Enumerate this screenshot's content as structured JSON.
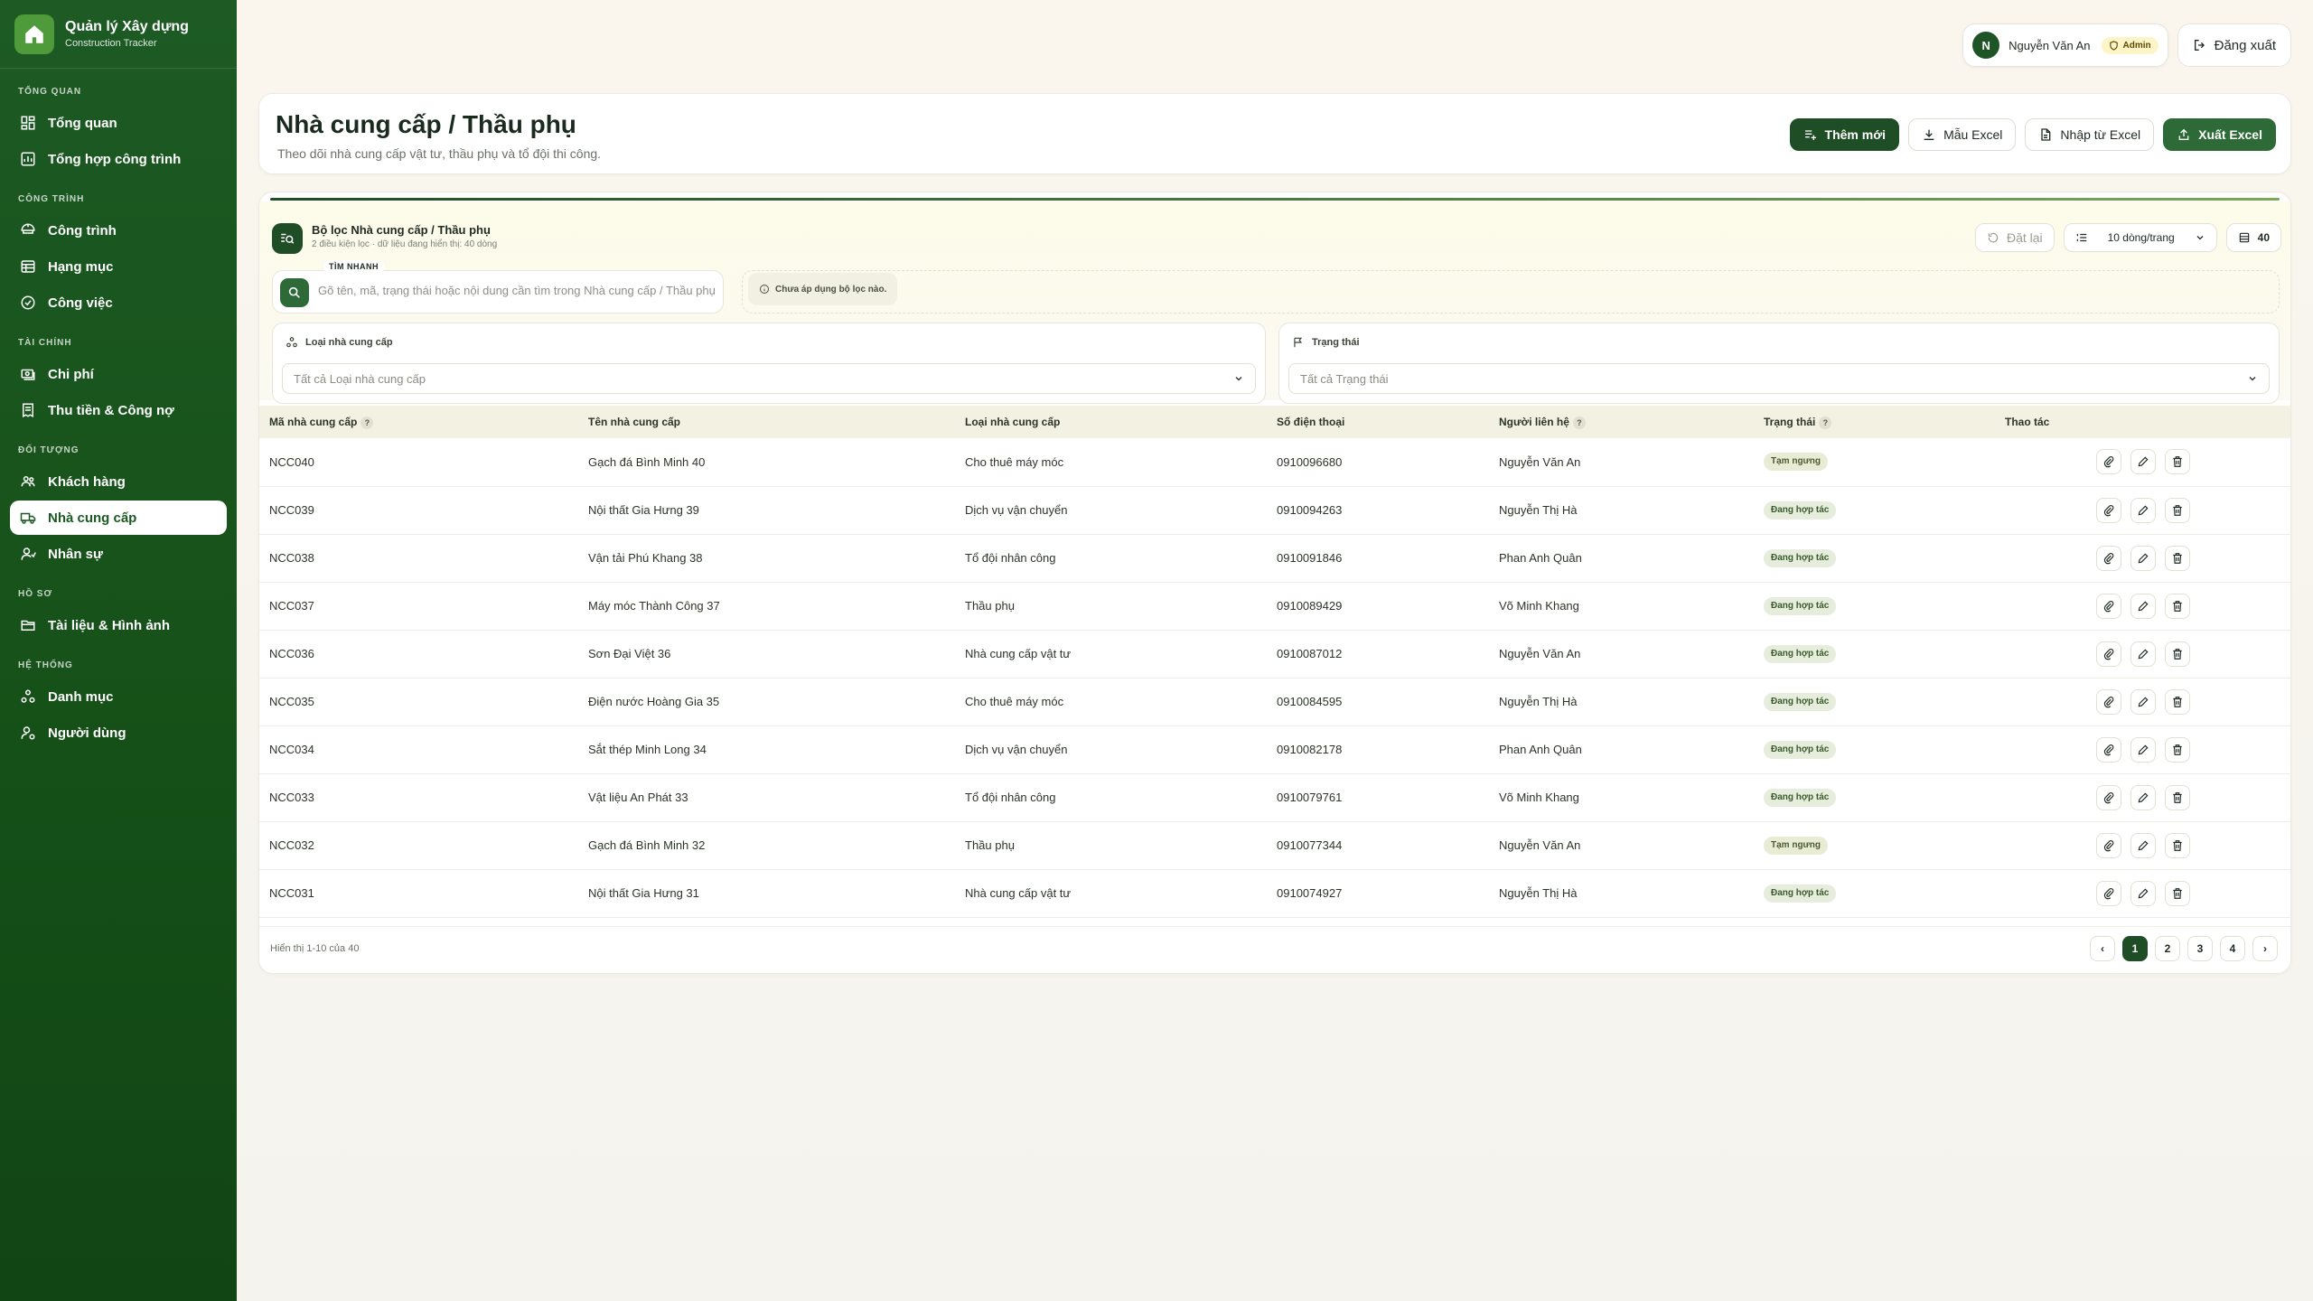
{
  "brand": {
    "title": "Quản lý Xây dựng",
    "subtitle": "Construction Tracker"
  },
  "sidebar": {
    "sections": [
      {
        "title": "TỔNG QUAN",
        "items": [
          {
            "label": "Tổng quan",
            "icon": "dashboard-icon"
          },
          {
            "label": "Tổng hợp công trình",
            "icon": "summary-icon"
          }
        ]
      },
      {
        "title": "CÔNG TRÌNH",
        "items": [
          {
            "label": "Công trình",
            "icon": "project-icon"
          },
          {
            "label": "Hạng mục",
            "icon": "list-icon"
          },
          {
            "label": "Công việc",
            "icon": "task-icon"
          }
        ]
      },
      {
        "title": "TÀI CHÍNH",
        "items": [
          {
            "label": "Chi phí",
            "icon": "money-icon"
          },
          {
            "label": "Thu tiền & Công nợ",
            "icon": "receipt-icon"
          }
        ]
      },
      {
        "title": "ĐỐI TƯỢNG",
        "items": [
          {
            "label": "Khách hàng",
            "icon": "users-icon"
          },
          {
            "label": "Nhà cung cấp",
            "icon": "truck-icon",
            "active": true
          },
          {
            "label": "Nhân sự",
            "icon": "staff-icon"
          }
        ]
      },
      {
        "title": "HỒ SƠ",
        "items": [
          {
            "label": "Tài liệu & Hình ảnh",
            "icon": "folder-icon"
          }
        ]
      },
      {
        "title": "HỆ THỐNG",
        "items": [
          {
            "label": "Danh mục",
            "icon": "category-icon"
          },
          {
            "label": "Người dùng",
            "icon": "user-settings-icon"
          }
        ]
      }
    ]
  },
  "topbar": {
    "avatar_initial": "N",
    "user_name": "Nguyễn Văn An",
    "role": "Admin",
    "logout": "Đăng xuất"
  },
  "page": {
    "title": "Nhà cung cấp / Thầu phụ",
    "subtitle": "Theo dõi nhà cung cấp vật tư, thầu phụ và tổ đội thi công.",
    "actions": {
      "add": "Thêm mới",
      "template": "Mẫu Excel",
      "import": "Nhập từ Excel",
      "export": "Xuất Excel"
    }
  },
  "filter": {
    "title": "Bộ lọc Nhà cung cấp / Thầu phụ",
    "subtitle": "2 điều kiện lọc · dữ liệu đang hiển thị: 40 dòng",
    "reset": "Đặt lại",
    "page_size": "10 dòng/trang",
    "total": "40",
    "quick_label": "TÌM NHANH",
    "quick_placeholder": "Gõ tên, mã, trạng thái hoặc nội dung cần tìm trong Nhà cung cấp / Thầu phụ",
    "no_filter": "Chưa áp dụng bộ lọc nào.",
    "type_label": "Loại nhà cung cấp",
    "type_value": "Tất cả Loại nhà cung cấp",
    "status_label": "Trạng thái",
    "status_value": "Tất cả Trạng thái"
  },
  "table": {
    "columns": [
      "Mã nhà cung cấp",
      "Tên nhà cung cấp",
      "Loại nhà cung cấp",
      "Số điện thoại",
      "Người liên hệ",
      "Trạng thái",
      "Thao tác"
    ],
    "rows": [
      {
        "code": "NCC040",
        "name": "Gạch đá Bình Minh 40",
        "type": "Cho thuê máy móc",
        "phone": "0910096680",
        "contact": "Nguyễn Văn An",
        "status": "Tạm ngưng",
        "status_kind": "pause"
      },
      {
        "code": "NCC039",
        "name": "Nội thất Gia Hưng 39",
        "type": "Dịch vụ vận chuyển",
        "phone": "0910094263",
        "contact": "Nguyễn Thị Hà",
        "status": "Đang hợp tác",
        "status_kind": "ok"
      },
      {
        "code": "NCC038",
        "name": "Vận tải Phú Khang 38",
        "type": "Tổ đội nhân công",
        "phone": "0910091846",
        "contact": "Phan Anh Quân",
        "status": "Đang hợp tác",
        "status_kind": "ok"
      },
      {
        "code": "NCC037",
        "name": "Máy móc Thành Công 37",
        "type": "Thầu phụ",
        "phone": "0910089429",
        "contact": "Võ Minh Khang",
        "status": "Đang hợp tác",
        "status_kind": "ok"
      },
      {
        "code": "NCC036",
        "name": "Sơn Đại Việt 36",
        "type": "Nhà cung cấp vật tư",
        "phone": "0910087012",
        "contact": "Nguyễn Văn An",
        "status": "Đang hợp tác",
        "status_kind": "ok"
      },
      {
        "code": "NCC035",
        "name": "Điện nước Hoàng Gia 35",
        "type": "Cho thuê máy móc",
        "phone": "0910084595",
        "contact": "Nguyễn Thị Hà",
        "status": "Đang hợp tác",
        "status_kind": "ok"
      },
      {
        "code": "NCC034",
        "name": "Sắt thép Minh Long 34",
        "type": "Dịch vụ vận chuyển",
        "phone": "0910082178",
        "contact": "Phan Anh Quân",
        "status": "Đang hợp tác",
        "status_kind": "ok"
      },
      {
        "code": "NCC033",
        "name": "Vật liệu An Phát 33",
        "type": "Tổ đội nhân công",
        "phone": "0910079761",
        "contact": "Võ Minh Khang",
        "status": "Đang hợp tác",
        "status_kind": "ok"
      },
      {
        "code": "NCC032",
        "name": "Gạch đá Bình Minh 32",
        "type": "Thầu phụ",
        "phone": "0910077344",
        "contact": "Nguyễn Văn An",
        "status": "Tạm ngưng",
        "status_kind": "pause"
      },
      {
        "code": "NCC031",
        "name": "Nội thất Gia Hưng 31",
        "type": "Nhà cung cấp vật tư",
        "phone": "0910074927",
        "contact": "Nguyễn Thị Hà",
        "status": "Đang hợp tác",
        "status_kind": "ok"
      }
    ],
    "footer": "Hiển thị 1-10 của 40",
    "pages": [
      "1",
      "2",
      "3",
      "4"
    ],
    "prev": "‹",
    "next": "›"
  },
  "colors": {
    "sidebar": "#165219",
    "accent": "#1e4d26",
    "button_green": "#2d6a37"
  }
}
